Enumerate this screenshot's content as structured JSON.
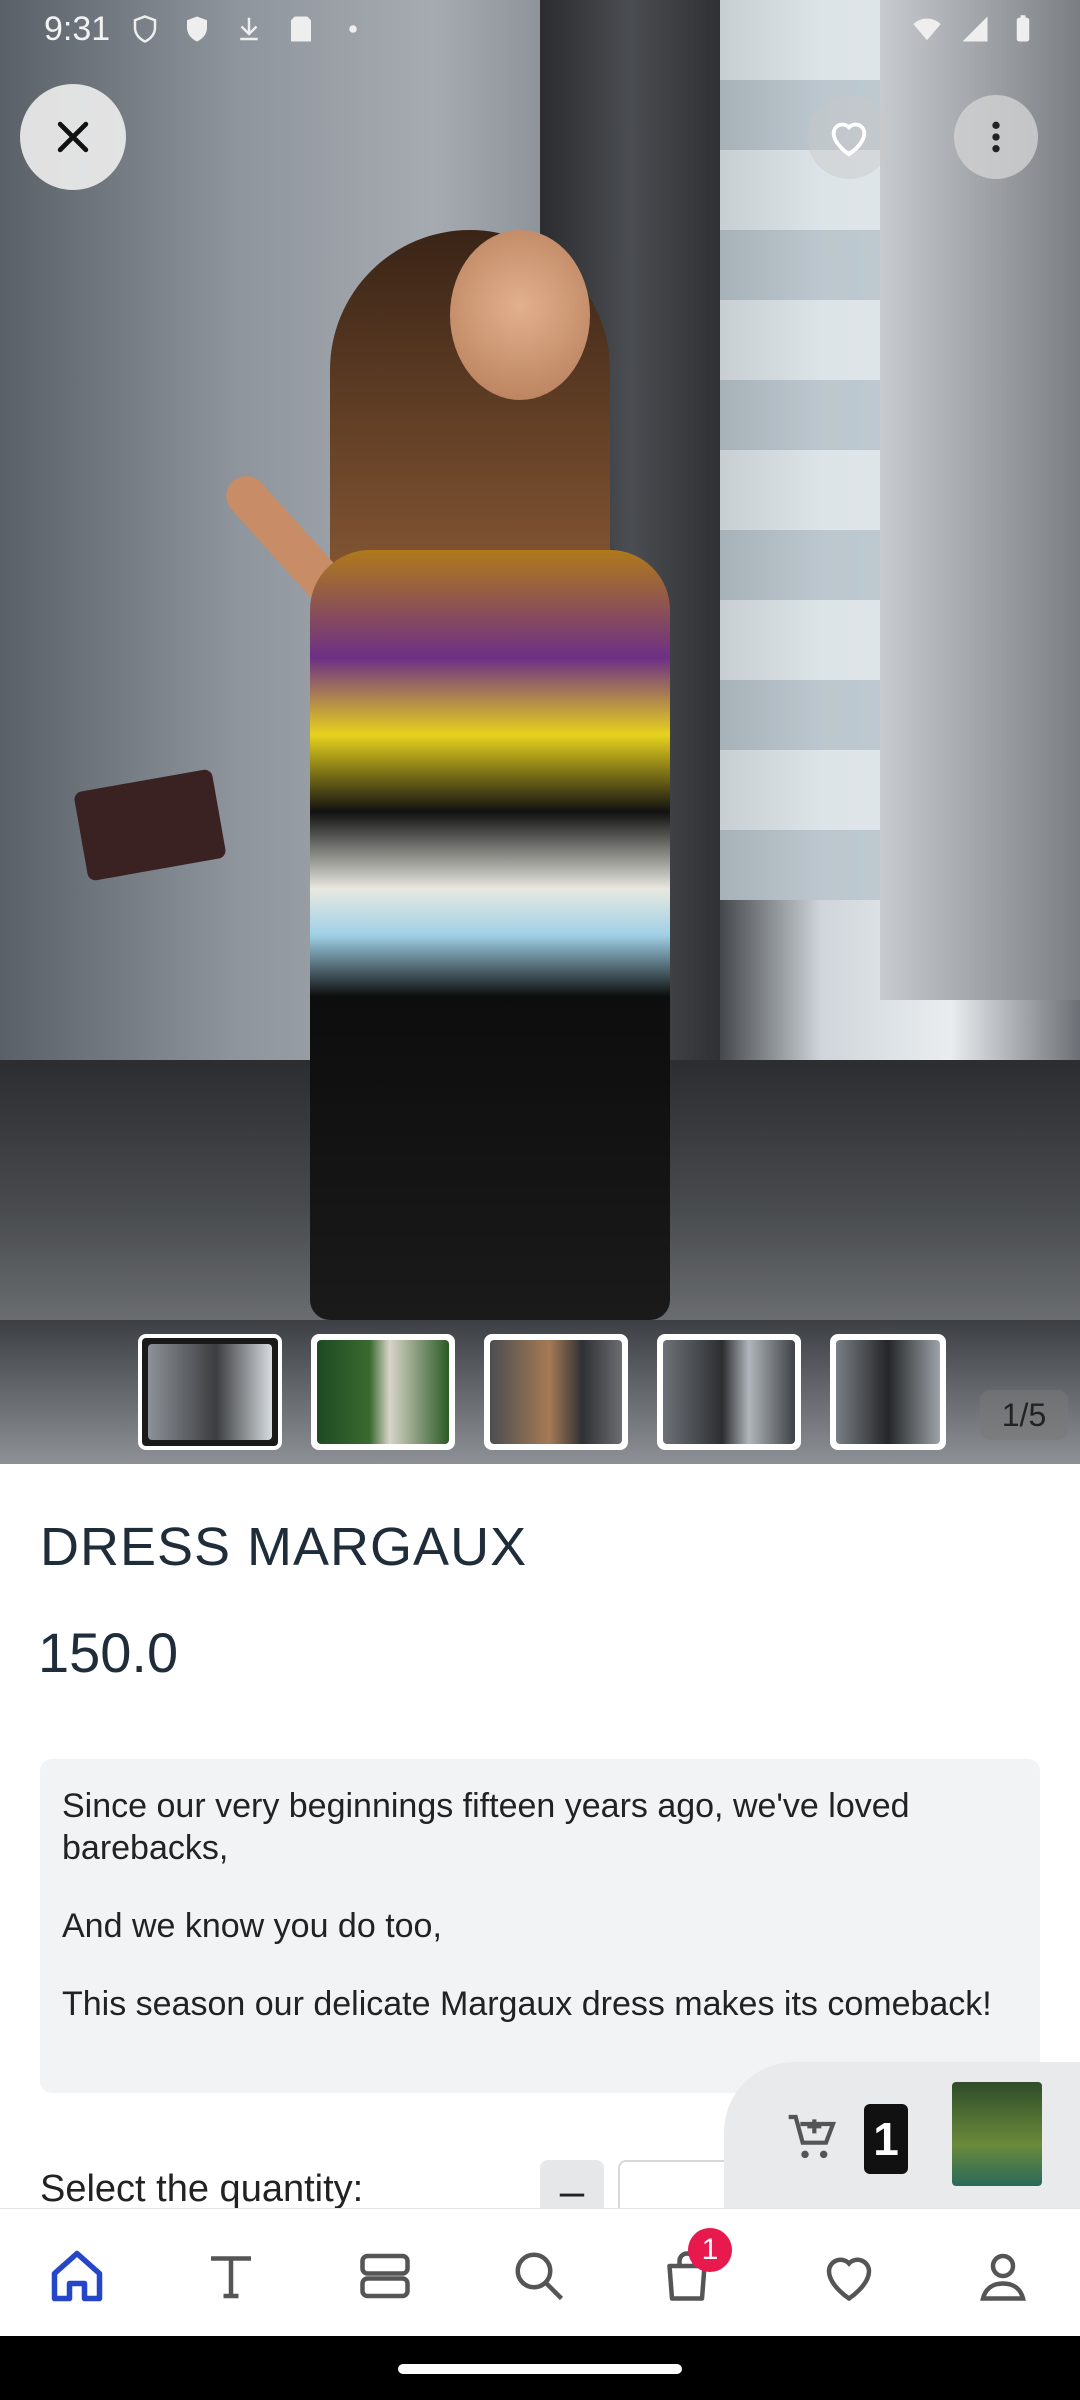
{
  "status_bar": {
    "time": "9:31"
  },
  "gallery": {
    "counter": "1/5",
    "thumbnail_count": 5
  },
  "product": {
    "title": "DRESS MARGAUX",
    "price": "150.0",
    "description": [
      "Since our very beginnings fifteen years ago, we've loved barebacks,",
      "And we know you do too,",
      "This season our delicate Margaux dress makes its comeback!"
    ]
  },
  "quantity": {
    "label": "Select the quantity:",
    "minus_symbol": "–"
  },
  "mini_cart": {
    "count": "1"
  },
  "bottom_nav": {
    "cart_badge": "1",
    "active": "home"
  },
  "colors": {
    "accent": "#2546c9",
    "badge": "#e8194d",
    "nav_icon": "#555555"
  }
}
